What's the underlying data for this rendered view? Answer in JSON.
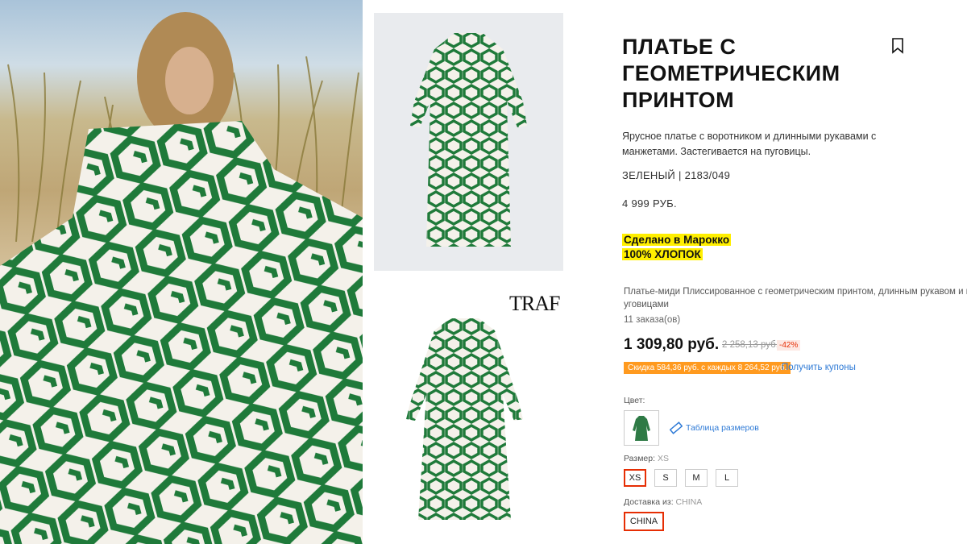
{
  "product": {
    "title": "ПЛАТЬЕ С ГЕОМЕТРИЧЕСКИМ ПРИНТОМ",
    "description": "Ярусное платье с воротником и длинными рукавами с манжетами. Застегивается на пуговицы.",
    "color_code": "ЗЕЛЕНЫЙ | 2183/049",
    "price": "4 999 РУБ.",
    "made_in": "Сделано в Марокко",
    "material": "100% ХЛОПОК"
  },
  "brand": {
    "logo_text": "TRAF"
  },
  "aliexpress": {
    "description": "Платье-миди Плиссированное с геометрическим принтом, длинным рукавом и п",
    "description_line2": "уговицами",
    "orders": "11 заказа(ов)",
    "price": "1 309,80 руб.",
    "old_price": "2 258,13 руб.",
    "discount": "-42%",
    "promo": "Скидка 584,36 руб. с каждых 8 264,52 руб.",
    "coupons_link": "Получить купоны",
    "color_label": "Цвет:",
    "size_chart": "Таблица размеров",
    "size_label": "Размер:",
    "size_selected": "XS",
    "sizes": [
      "XS",
      "S",
      "M",
      "L"
    ],
    "ship_label": "Доставка из:",
    "ship_selected": "CHINA",
    "ship_option": "CHINA"
  },
  "colors": {
    "green": "#1f7a3a",
    "accent_red": "#e62e04",
    "highlight": "#ffef00",
    "promo": "#ff9a1f",
    "link": "#2e7ad6"
  },
  "icons": {
    "bookmark": "bookmark-icon",
    "ruler": "ruler-icon"
  }
}
